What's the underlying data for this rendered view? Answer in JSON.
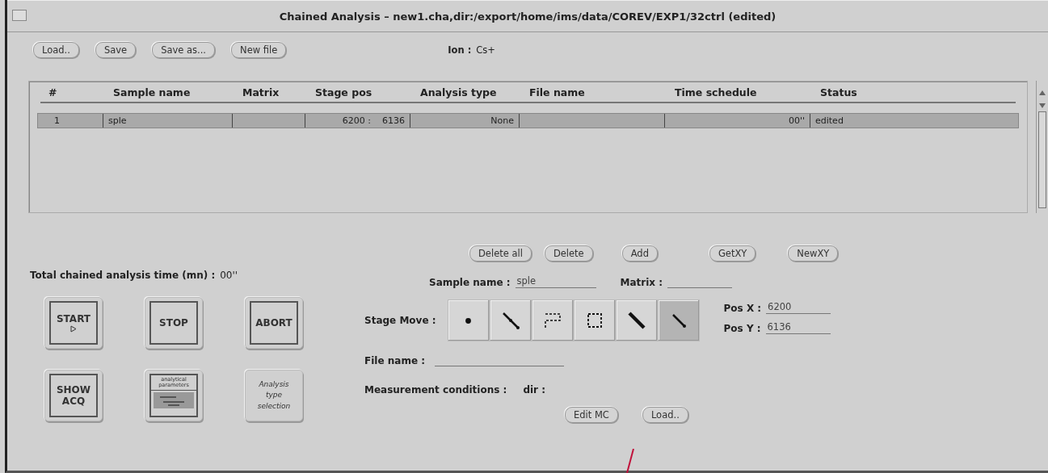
{
  "window": {
    "title": "Chained Analysis – new1.cha,dir:/export/home/ims/data/COREV/EXP1/32ctrl (edited)"
  },
  "toolbar": {
    "buttons": [
      "Load..",
      "Save",
      "Save as...",
      "New file"
    ],
    "ion_label": "Ion :",
    "ion_value": "Cs+"
  },
  "table": {
    "columns": [
      "#",
      "Sample name",
      "Matrix",
      "Stage pos",
      "Analysis type",
      "File name",
      "Time schedule",
      "Status"
    ],
    "rows": [
      {
        "selected": true,
        "number": "1",
        "sample_name": "sple",
        "stage_pos": "6200 :    6136",
        "analysis_type": "None",
        "time_schedule": "00''",
        "status": "edited"
      }
    ]
  },
  "list_buttons": [
    "Delete all",
    "Delete",
    "Add",
    "GetXY",
    "NewXY"
  ],
  "total_time": {
    "label": "Total chained analysis time (mn) :",
    "value": "00''"
  },
  "actions": [
    {
      "kind": "start",
      "label": "START"
    },
    {
      "kind": "text",
      "label": "STOP"
    },
    {
      "kind": "text",
      "label": "ABORT"
    },
    {
      "kind": "text",
      "label": "SHOW ACQ"
    },
    {
      "kind": "params",
      "label": "analytical parameters"
    },
    {
      "kind": "italic",
      "label": "Analysis type selection"
    }
  ],
  "sample_name": {
    "label": "Sample name :",
    "value": "sple"
  },
  "matrix": {
    "label": "Matrix :"
  },
  "stage_move": {
    "label": "Stage Move :",
    "modes": [
      {
        "kind": "point",
        "selected": false
      },
      {
        "kind": "line",
        "selected": false
      },
      {
        "kind": "grid",
        "selected": false
      },
      {
        "kind": "square",
        "selected": false
      },
      {
        "kind": "thick",
        "selected": false
      },
      {
        "kind": "short",
        "selected": true
      }
    ]
  },
  "pos_x": {
    "label": "Pos X :",
    "value": "6200"
  },
  "pos_y": {
    "label": "Pos Y :",
    "value": "6136"
  },
  "file_name": {
    "label": "File name :"
  },
  "measurement": {
    "label": "Measurement conditions :",
    "dir_label": "dir :"
  },
  "mc_buttons": [
    "Edit MC",
    "Load.."
  ]
}
